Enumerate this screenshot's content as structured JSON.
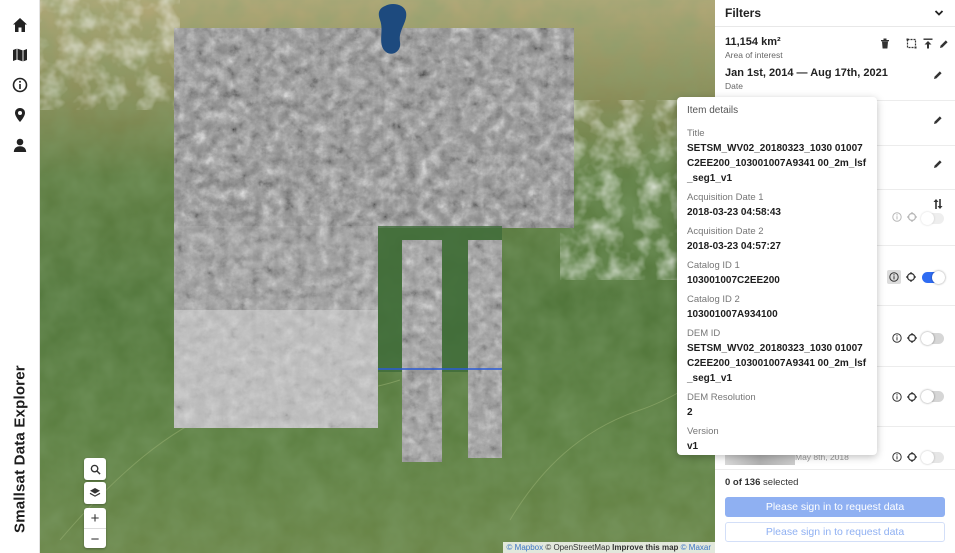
{
  "app": {
    "title": "Smallsat Data Explorer",
    "colors": {
      "accent": "#2f6cf2",
      "button_disabled": "#8fb0f2"
    }
  },
  "rail": {
    "icons": [
      "home-icon",
      "map-icon",
      "info-icon",
      "location-pin-icon",
      "user-icon"
    ]
  },
  "map": {
    "controls": {
      "search_icon": "search-icon",
      "layers_icon": "layers-icon",
      "zoom_in": "+",
      "zoom_out": "−"
    },
    "attribution": {
      "mapbox": "© Mapbox",
      "osm": "© OpenStreetMap",
      "improve": "Improve this map",
      "maxar": "© Maxar"
    }
  },
  "popup": {
    "header": "Item details",
    "fields": [
      {
        "label": "Title",
        "value": "SETSM_WV02_20180323_1030 01007C2EE200_103001007A9341 00_2m_lsf_seg1_v1"
      },
      {
        "label": "Acquisition Date 1",
        "value": "2018-03-23 04:58:43"
      },
      {
        "label": "Acquisition Date 2",
        "value": "2018-03-23 04:57:27"
      },
      {
        "label": "Catalog ID 1",
        "value": "103001007C2EE200"
      },
      {
        "label": "Catalog ID 2",
        "value": "103001007A934100"
      },
      {
        "label": "DEM ID",
        "value": "SETSM_WV02_20180323_1030 01007C2EE200_103001007A9341 00_2m_lsf_seg1_v1"
      },
      {
        "label": "DEM Resolution",
        "value": "2"
      },
      {
        "label": "Version",
        "value": "v1"
      }
    ]
  },
  "panel": {
    "header": "Filters",
    "aoi": {
      "value": "11,154 km²",
      "label": "Area of interest"
    },
    "date": {
      "value": "Jan 1st, 2014 — Aug 17th, 2021",
      "label": "Date"
    },
    "items": [
      {
        "toggle_on": false
      },
      {
        "toggle_on": true
      },
      {
        "toggle_on": false
      },
      {
        "toggle_on": false
      },
      {
        "toggle_on": false,
        "date": "May 8th, 2018"
      }
    ],
    "selection": {
      "count": "0 of 136",
      "suffix": " selected"
    },
    "buttons": {
      "request_primary": "Please sign in to request data",
      "request_secondary": "Please sign in to request data"
    }
  }
}
